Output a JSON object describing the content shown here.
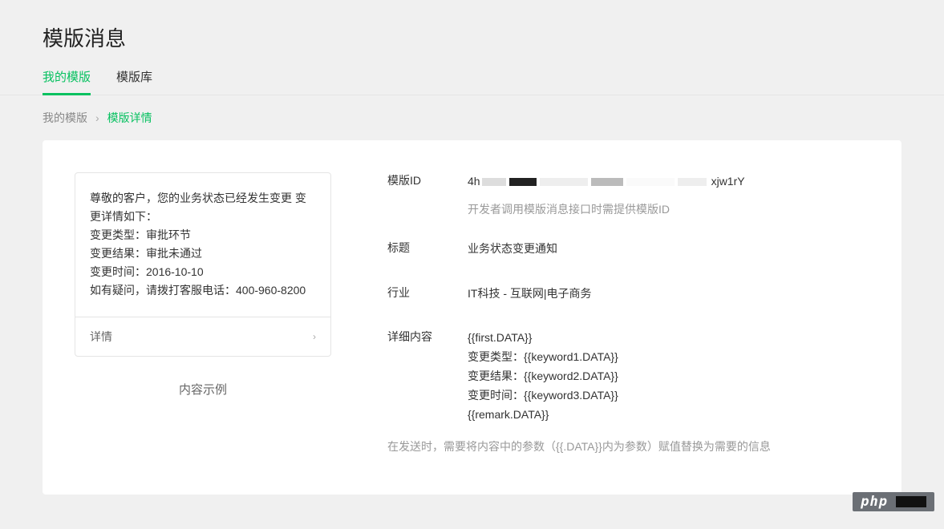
{
  "page": {
    "title": "模版消息"
  },
  "tabs": [
    {
      "label": "我的模版",
      "active": true
    },
    {
      "label": "模版库",
      "active": false
    }
  ],
  "breadcrumb": {
    "prev": "我的模版",
    "current": "模版详情"
  },
  "preview": {
    "line1": "尊敬的客户，您的业务状态已经发生变更 变更详情如下：",
    "line2": "变更类型：审批环节",
    "line3": "变更结果：审批未通过",
    "line4": "变更时间：2016-10-10",
    "line5": "如有疑问，请拨打客服电话：400-960-8200",
    "detail_label": "详情"
  },
  "example_label": "内容示例",
  "fields": {
    "template_id_label": "模版ID",
    "template_id_prefix": "4h",
    "template_id_suffix": "xjw1rY",
    "template_id_hint": "开发者调用模版消息接口时需提供模版ID",
    "title_label": "标题",
    "title_value": "业务状态变更通知",
    "industry_label": "行业",
    "industry_value": "IT科技 - 互联网|电子商务",
    "content_label": "详细内容",
    "content_lines": {
      "l1": "{{first.DATA}}",
      "l2": "变更类型：{{keyword1.DATA}}",
      "l3": "变更结果：{{keyword2.DATA}}",
      "l4": "变更时间：{{keyword3.DATA}}",
      "l5": "{{remark.DATA}}"
    },
    "send_note": "在发送时，需要将内容中的参数（{{.DATA}}内为参数）赋值替换为需要的信息"
  },
  "watermark": "php"
}
